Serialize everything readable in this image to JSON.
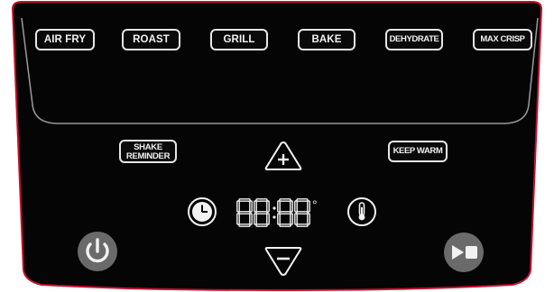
{
  "function_buttons": [
    {
      "id": "air-fry",
      "label": "AIR FRY"
    },
    {
      "id": "roast",
      "label": "ROAST"
    },
    {
      "id": "grill",
      "label": "GRILL"
    },
    {
      "id": "bake",
      "label": "BAKE"
    },
    {
      "id": "dehydrate",
      "label": "DEHYDRATE"
    },
    {
      "id": "max-crisp",
      "label": "MAX CRISP"
    }
  ],
  "shake_reminder": {
    "line1": "SHAKE",
    "line2": "REMINDER"
  },
  "keep_warm": {
    "label": "KEEP WARM"
  },
  "display": {
    "readout": "88:88",
    "degree_symbol": "°"
  },
  "icons": {
    "increase": "plus-triangle-icon",
    "decrease": "minus-triangle-icon",
    "time": "clock-icon",
    "temperature": "thermometer-icon",
    "power": "power-icon",
    "start_pause": "play-pause-icon"
  },
  "colors": {
    "panel": "#050505",
    "panel_border": "#c8102e",
    "divider": "#9a9a9a",
    "power_button": "#6a6a6a",
    "icon_white": "#f2f2f2"
  }
}
